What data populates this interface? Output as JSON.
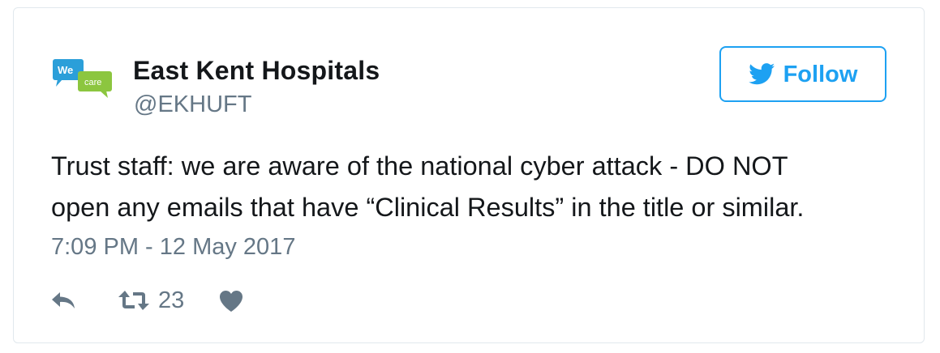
{
  "author": {
    "display_name": "East Kent Hospitals",
    "handle": "@EKHUFT",
    "avatar": {
      "icon": "we-care-logo",
      "text_top": "We",
      "text_bottom": "care",
      "colors": {
        "blue": "#2b9fd9",
        "green": "#8cc63f"
      }
    }
  },
  "follow_button": {
    "label": "Follow",
    "icon": "twitter-bird-icon",
    "color": "#1da1f2"
  },
  "tweet": {
    "text_line1": "Trust staff: we are aware of the national cyber attack - DO NOT",
    "text_line2": "open any emails that have “Clinical Results” in the title or similar.",
    "timestamp": "7:09 PM - 12 May 2017"
  },
  "actions": {
    "reply": {
      "icon": "reply-icon"
    },
    "retweet": {
      "icon": "retweet-icon",
      "count": "23"
    },
    "like": {
      "icon": "heart-icon"
    },
    "icon_color": "#657786"
  }
}
